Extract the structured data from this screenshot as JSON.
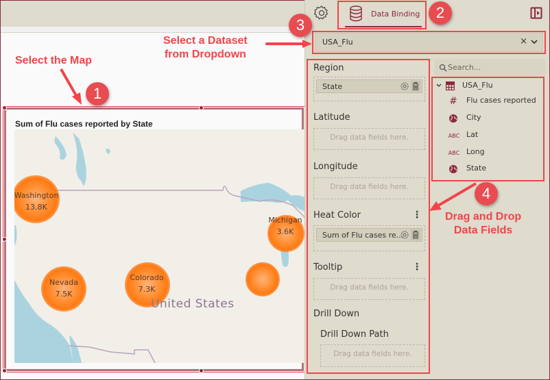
{
  "colors": {
    "accent": "#8a2a3a",
    "annotation": "#f0454a",
    "panel_bg": "#dfdbcd",
    "heat": "#ff7a14"
  },
  "toolbar": {
    "settings_icon": "gear-icon",
    "active_tab_label": "Data Binding",
    "active_tab_icon": "database-icon",
    "panel_toggle_icon": "panel-collapse-icon"
  },
  "dataset": {
    "selected": "USA_Flu",
    "clear_label": "×"
  },
  "bindings": {
    "region": {
      "label": "Region",
      "field": "State"
    },
    "latitude": {
      "label": "Latitude",
      "placeholder": "Drag data fields here."
    },
    "longitude": {
      "label": "Longitude",
      "placeholder": "Drag data fields here."
    },
    "heat_color": {
      "label": "Heat Color",
      "field": "Sum of Flu cases re..."
    },
    "tooltip": {
      "label": "Tooltip",
      "placeholder": "Drag data fields here."
    },
    "drill_down": {
      "label": "Drill Down",
      "path_label": "Drill Down Path",
      "placeholder": "Drag data fields here."
    },
    "menu_glyph": "⋮"
  },
  "fields": {
    "search_placeholder": "Search...",
    "dataset_name": "USA_Flu",
    "items": [
      {
        "name": "Flu cases reported",
        "type_icon": "#",
        "type": "numeric"
      },
      {
        "name": "City",
        "type_icon": "globe-icon",
        "type": "geo"
      },
      {
        "name": "Lat",
        "type_icon": "ABC",
        "type": "text"
      },
      {
        "name": "Long",
        "type_icon": "ABC",
        "type": "text"
      },
      {
        "name": "State",
        "type_icon": "globe-icon",
        "type": "geo"
      }
    ]
  },
  "widget": {
    "title": "Sum of Flu cases reported by State",
    "country_label": "United States",
    "points": [
      {
        "state": "Washington",
        "value": "13.8K"
      },
      {
        "state": "Michigan",
        "value": "3.6K"
      },
      {
        "state": "Nevada",
        "value": "7.5K"
      },
      {
        "state": "Colorado",
        "value": "7.3K"
      },
      {
        "state": "",
        "value": ""
      }
    ]
  },
  "annotations": {
    "step1": {
      "number": "1",
      "text": "Select the Map"
    },
    "step2": {
      "number": "2"
    },
    "step3": {
      "number": "3",
      "text_line1": "Select a Dataset",
      "text_line2": "from Dropdown"
    },
    "step4": {
      "number": "4",
      "text_line1": "Drag and Drop",
      "text_line2": "Data Fields"
    }
  }
}
